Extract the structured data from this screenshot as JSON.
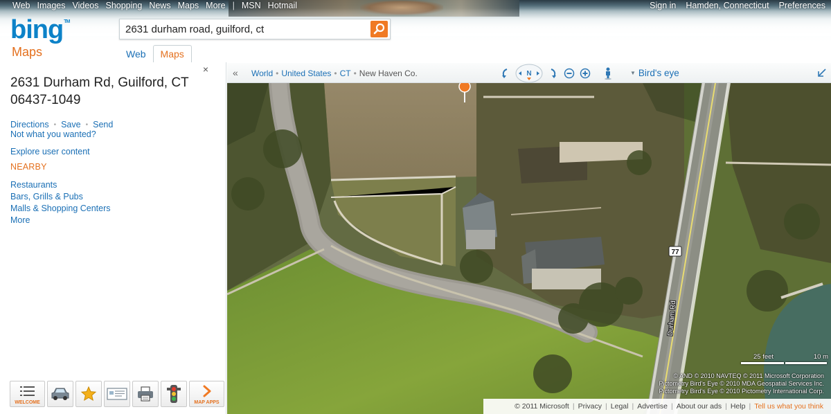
{
  "top_nav": {
    "left": [
      "Web",
      "Images",
      "Videos",
      "Shopping",
      "News",
      "Maps",
      "More"
    ],
    "separator": "|",
    "msn": "MSN",
    "hotmail": "Hotmail",
    "right": [
      "Sign in",
      "Hamden, Connecticut",
      "Preferences"
    ]
  },
  "brand": {
    "logo_text": "bing",
    "tm": "TM",
    "section_title": "Maps",
    "accent_color": "#e4701e",
    "logo_color": "#0c82c8",
    "link_color": "#1a6fb5"
  },
  "search": {
    "value": "2631 durham road, guilford, ct",
    "button_icon": "search-icon"
  },
  "scope_tabs": [
    {
      "label": "Web",
      "active": false
    },
    {
      "label": "Maps",
      "active": true
    }
  ],
  "panel": {
    "close_glyph": "×",
    "address_line1": "2631 Durham Rd, Guilford, CT",
    "address_line2": "06437-1049",
    "actions": [
      "Directions",
      "Save",
      "Send"
    ],
    "not_wanted": "Not what you wanted?",
    "explore": "Explore user content",
    "nearby_heading": "NEARBY",
    "nearby_items": [
      "Restaurants",
      "Bars, Grills & Pubs",
      "Malls & Shopping Centers",
      "More"
    ]
  },
  "app_toolbar": {
    "welcome_label": "WELCOME",
    "map_apps_label": "MAP APPS",
    "icons": [
      "list-icon",
      "car-icon",
      "star-icon",
      "card-icon",
      "printer-icon",
      "traffic-light-icon",
      "chevron-right-icon"
    ]
  },
  "map_toolbar": {
    "collapse_glyph": "«",
    "breadcrumb": [
      "World",
      "United States",
      "CT",
      "New Haven Co."
    ],
    "breadcrumb_sep": "•",
    "compass_label": "N",
    "view_mode": "Bird's eye"
  },
  "map": {
    "road_label": "Durham Rd",
    "route_shield": "77",
    "scale_feet": "25 feet",
    "scale_meters": "10 m",
    "attribution": [
      "© AND   © 2010 NAVTEQ   © 2011 Microsoft Corporation",
      "Pictometry Bird's Eye © 2010 MDA Geospatial Services Inc.",
      "Pictometry Bird's Eye © 2010 Pictometry International Corp."
    ]
  },
  "footer": {
    "copyright": "© 2011 Microsoft",
    "links": [
      "Privacy",
      "Legal",
      "Advertise",
      "About our ads",
      "Help"
    ],
    "feedback": "Tell us what you think"
  }
}
